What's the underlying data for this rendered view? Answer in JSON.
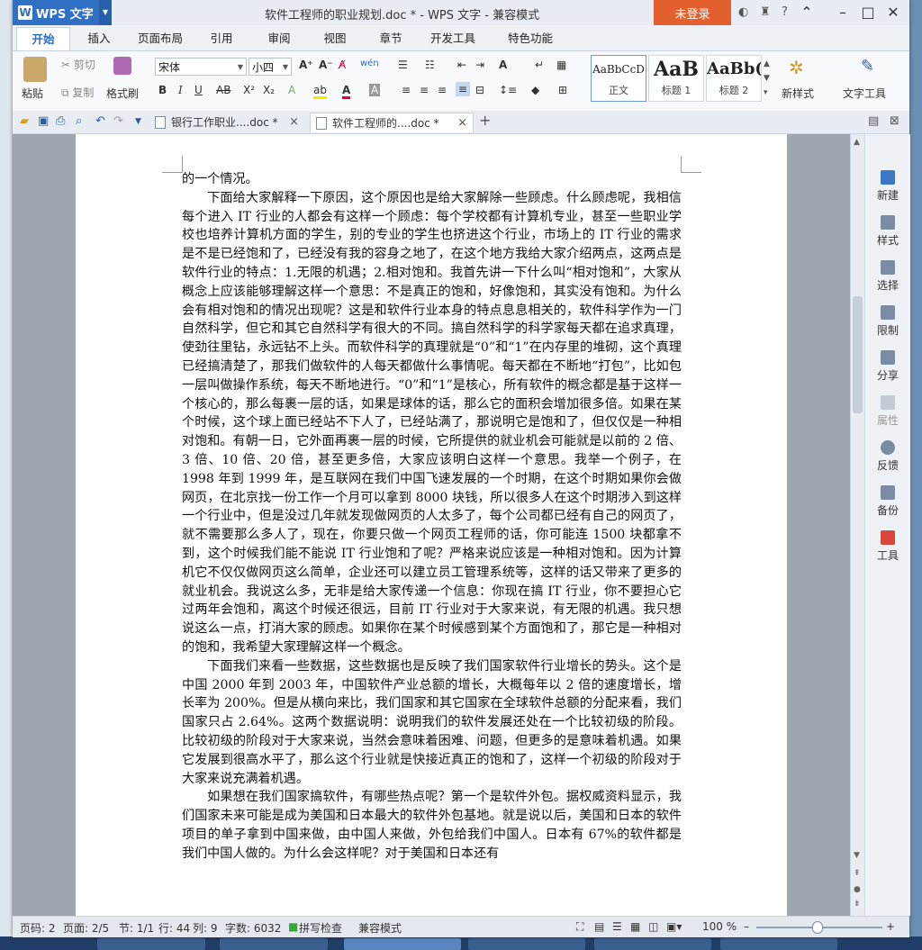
{
  "app": {
    "name": "WPS 文字",
    "title": "软件工程师的职业规划.doc * - WPS 文字 - 兼容模式",
    "login": "未登录"
  },
  "tabs": [
    "开始",
    "插入",
    "页面布局",
    "引用",
    "审阅",
    "视图",
    "章节",
    "开发工具",
    "特色功能"
  ],
  "ribbon": {
    "paste": "粘贴",
    "cut": "剪切",
    "copy": "复制",
    "format_painter": "格式刷",
    "font": "宋体",
    "size": "小四",
    "styles": [
      {
        "preview": "AaBbCcD",
        "name": "正文"
      },
      {
        "preview": "AaB",
        "name": "标题 1"
      },
      {
        "preview": "AaBb(",
        "name": "标题 2"
      }
    ],
    "new_style": "新样式",
    "text_tools": "文字工具"
  },
  "doc_tabs": [
    {
      "label": "银行工作职业....doc *",
      "active": false
    },
    {
      "label": "软件工程师的....doc *",
      "active": true
    }
  ],
  "document": {
    "paragraphs": [
      {
        "indent": false,
        "text": "的一个情况。"
      },
      {
        "indent": true,
        "text": "下面给大家解释一下原因，这个原因也是给大家解除一些顾虑。什么顾虑呢，我相信每个进入 IT 行业的人都会有这样一个顾虑：每个学校都有计算机专业，甚至一些职业学校也培养计算机方面的学生，别的专业的学生也挤进这个行业，市场上的 IT 行业的需求是不是已经饱和了，已经没有我的容身之地了，在这个地方我给大家介绍两点，这两点是软件行业的特点：1.无限的机遇；2.相对饱和。我首先讲一下什么叫“相对饱和”，大家从概念上应该能够理解这样一个意思：不是真正的饱和，好像饱和，其实没有饱和。为什么会有相对饱和的情况出现呢？这是和软件行业本身的特点息息相关的，软件科学作为一门自然科学，但它和其它自然科学有很大的不同。搞自然科学的科学家每天都在追求真理，使劲往里钻，永远钻不上头。而软件科学的真理就是“0”和“1”在内存里的堆砌，这个真理已经搞清楚了，那我们做软件的人每天都做什么事情呢。每天都在不断地“打包”，比如包一层叫做操作系统，每天不断地进行。“0”和“1”是核心，所有软件的概念都是基于这样一个核心的，那么每裹一层的话，如果是球体的话，那么它的面积会增加很多倍。如果在某个时候，这个球上面已经站不下人了，已经站满了，那说明它是饱和了，但仅仅是一种相对饱和。有朝一日，它外面再裹一层的时候，它所提供的就业机会可能就是以前的 2 倍、3 倍、10 倍、20 倍，甚至更多倍，大家应该明白这样一个意思。我举一个例子，在 1998 年到 1999 年，是互联网在我们中国飞速发展的一个时期，在这个时期如果你会做网页，在北京找一份工作一个月可以拿到 8000 块钱，所以很多人在这个时期涉入到这样一个行业中，但是没过几年就发现做网页的人太多了，每个公司都已经有自己的网页了，就不需要那么多人了，现在，你要只做一个网页工程师的话，你可能连 1500 块都拿不到，这个时候我们能不能说 IT 行业饱和了呢？严格来说应该是一种相对饱和。因为计算机它不仅仅做网页这么简单，企业还可以建立员工管理系统等，这样的话又带来了更多的就业机会。我说这么多，无非是给大家传递一个信息：你现在搞 IT 行业，你不要担心它过两年会饱和，离这个时候还很远，目前 IT 行业对于大家来说，有无限的机遇。我只想说这么一点，打消大家的顾虑。如果你在某个时候感到某个方面饱和了，那它是一种相对的饱和，我希望大家理解这样一个概念。"
      },
      {
        "indent": true,
        "text": "下面我们来看一些数据，这些数据也是反映了我们国家软件行业增长的势头。这个是中国 2000 年到 2003 年，中国软件产业总额的增长，大概每年以 2 倍的速度增长，增长率为 200%。但是从横向来比，我们国家和其它国家在全球软件总额的分配来看，我们国家只占 2.64%。这两个数据说明：说明我们的软件发展还处在一个比较初级的阶段。比较初级的阶段对于大家来说，当然会意味着困难、问题，但更多的是意味着机遇。如果它发展到很高水平了，那么这个行业就是快接近真正的饱和了，这样一个初级的阶段对于大家来说充满着机遇。"
      },
      {
        "indent": true,
        "text": "如果想在我们国家搞软件，有哪些热点呢？第一个是软件外包。据权威资料显示，我们国家未来可能是成为美国和日本最大的软件外包基地。就是说以后，美国和日本的软件项目的单子拿到中国来做，由中国人来做，外包给我们中国人。日本有 67%的软件都是我们中国人做的。为什么会这样呢？对于美国和日本还有"
      }
    ]
  },
  "right_pane": [
    "新建",
    "样式",
    "选择",
    "限制",
    "分享",
    "属性",
    "反馈",
    "备份",
    "工具"
  ],
  "status": {
    "page": "页码: 2",
    "pages": "页面: 2/5",
    "section": "节: 1/1",
    "line": "行: 44",
    "col": "列: 9",
    "words": "字数: 6032",
    "spell": "拼写检查",
    "mode": "兼容模式",
    "zoom": "100 %"
  }
}
